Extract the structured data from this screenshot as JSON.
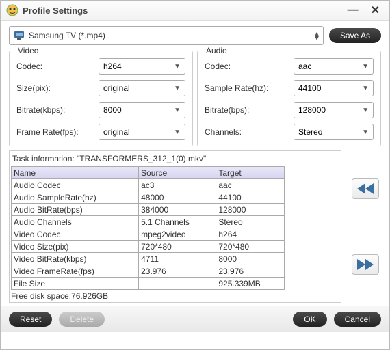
{
  "window": {
    "title": "Profile Settings"
  },
  "profile": {
    "selected": "Samsung TV (*.mp4)",
    "saveas": "Save As"
  },
  "video": {
    "legend": "Video",
    "codec_label": "Codec:",
    "codec": "h264",
    "size_label": "Size(pix):",
    "size": "original",
    "bitrate_label": "Bitrate(kbps):",
    "bitrate": "8000",
    "framerate_label": "Frame Rate(fps):",
    "framerate": "original"
  },
  "audio": {
    "legend": "Audio",
    "codec_label": "Codec:",
    "codec": "aac",
    "samplerate_label": "Sample Rate(hz):",
    "samplerate": "44100",
    "bitrate_label": "Bitrate(bps):",
    "bitrate": "128000",
    "channels_label": "Channels:",
    "channels": "Stereo"
  },
  "task": {
    "header": "Task information: \"TRANSFORMERS_312_1(0).mkv\"",
    "cols": {
      "name": "Name",
      "source": "Source",
      "target": "Target"
    },
    "rows": [
      {
        "name": "Audio Codec",
        "source": "ac3",
        "target": "aac"
      },
      {
        "name": "Audio SampleRate(hz)",
        "source": "48000",
        "target": "44100"
      },
      {
        "name": "Audio BitRate(bps)",
        "source": "384000",
        "target": "128000"
      },
      {
        "name": "Audio Channels",
        "source": "5.1 Channels",
        "target": "Stereo"
      },
      {
        "name": "Video Codec",
        "source": "mpeg2video",
        "target": "h264"
      },
      {
        "name": "Video Size(pix)",
        "source": "720*480",
        "target": "720*480"
      },
      {
        "name": "Video BitRate(kbps)",
        "source": "4711",
        "target": "8000"
      },
      {
        "name": "Video FrameRate(fps)",
        "source": "23.976",
        "target": "23.976"
      },
      {
        "name": "File Size",
        "source": "",
        "target": "925.339MB"
      }
    ],
    "freedisk": "Free disk space:76.926GB"
  },
  "buttons": {
    "reset": "Reset",
    "delete": "Delete",
    "ok": "OK",
    "cancel": "Cancel"
  }
}
